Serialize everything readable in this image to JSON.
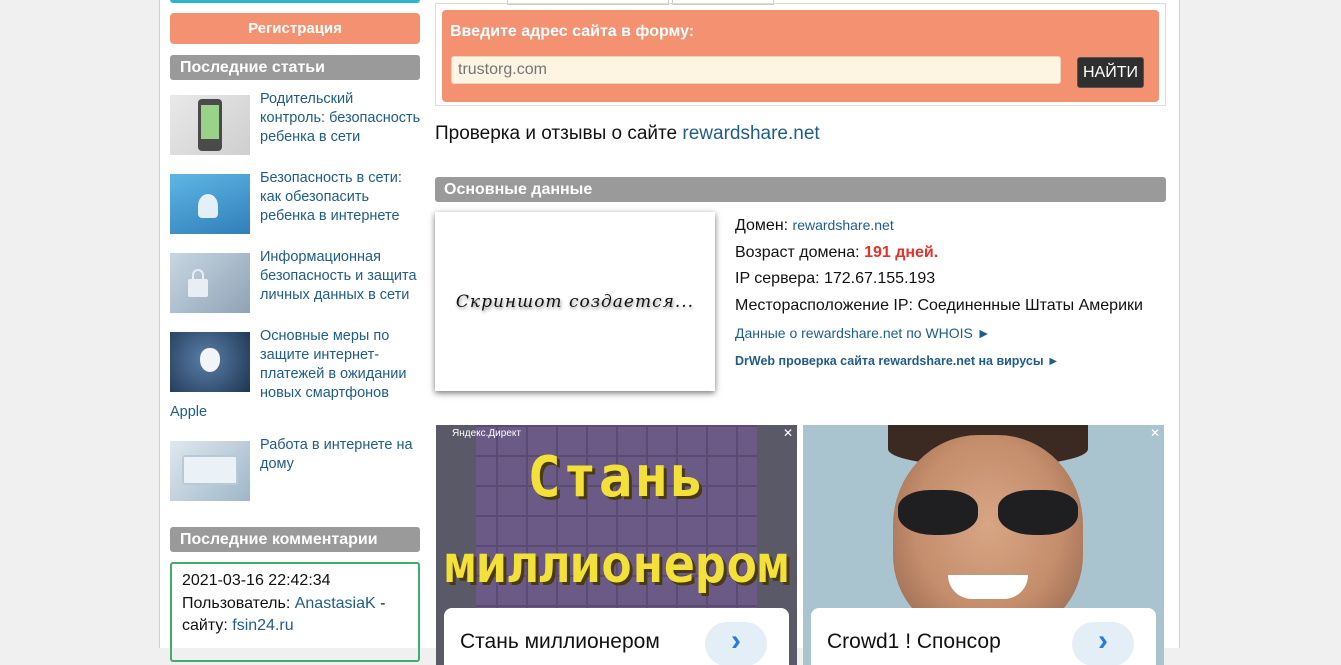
{
  "sidebar": {
    "register_label": "Регистрация",
    "articles_header": "Последние статьи",
    "articles": [
      {
        "title": "Родительский контроль: безопасность ребенка в сети",
        "icon": "phone-shield-icon"
      },
      {
        "title": "Безопасность в сети: как обезопасить ребенка в интернете",
        "icon": "network-icon"
      },
      {
        "title": "Информационная безопасность и защита личных данных в сети",
        "icon": "lock-icon"
      },
      {
        "title": "Основные меры по защите интернет-платежей в ожидании новых смартфонов Apple",
        "icon": "apple-icon"
      },
      {
        "title": "Работа в интернете на дому",
        "icon": "laptop-icon"
      }
    ],
    "comments_header": "Последние комментарии",
    "comment": {
      "date": "2021-03-16 22:42:34",
      "user_label": "Пользователь:",
      "user": "AnastasiaK",
      "dash": "-",
      "site_label": "сайту:",
      "site": "fsin24.ru"
    }
  },
  "search": {
    "label": "Введите адрес сайта в форму:",
    "placeholder": "trustorg.com",
    "button": "НАЙТИ"
  },
  "page": {
    "title_prefix": "Проверка и отзывы о сайте",
    "title_site": "rewardshare.net"
  },
  "basic": {
    "header": "Основные данные",
    "screenshot_text": "Скриншот создается...",
    "domain_label": "Домен:",
    "domain": "rewardshare.net",
    "age_label": "Возраст домена:",
    "age": "191 дней.",
    "ip_label": "IP сервера:",
    "ip": "172.67.155.193",
    "location_label": "Месторасположение IP:",
    "location": "Соединенные Штаты Америки",
    "whois_link": "Данные о rewardshare.net по WHOIS ►",
    "drweb_link": "DrWeb проверка сайта rewardshare.net на вирусы ►"
  },
  "ads": [
    {
      "source": "Яндекс.Директ",
      "line1": "Стань",
      "line2": "миллионером",
      "card_title": "Стань миллионером"
    },
    {
      "card_title": "Crowd1 ! Спонсор"
    }
  ],
  "colors": {
    "accent_orange": "#f39170",
    "header_gray": "#9a9a9a",
    "link": "#1f5c87",
    "red": "#e8322a",
    "comment_border": "#3fae6b"
  }
}
